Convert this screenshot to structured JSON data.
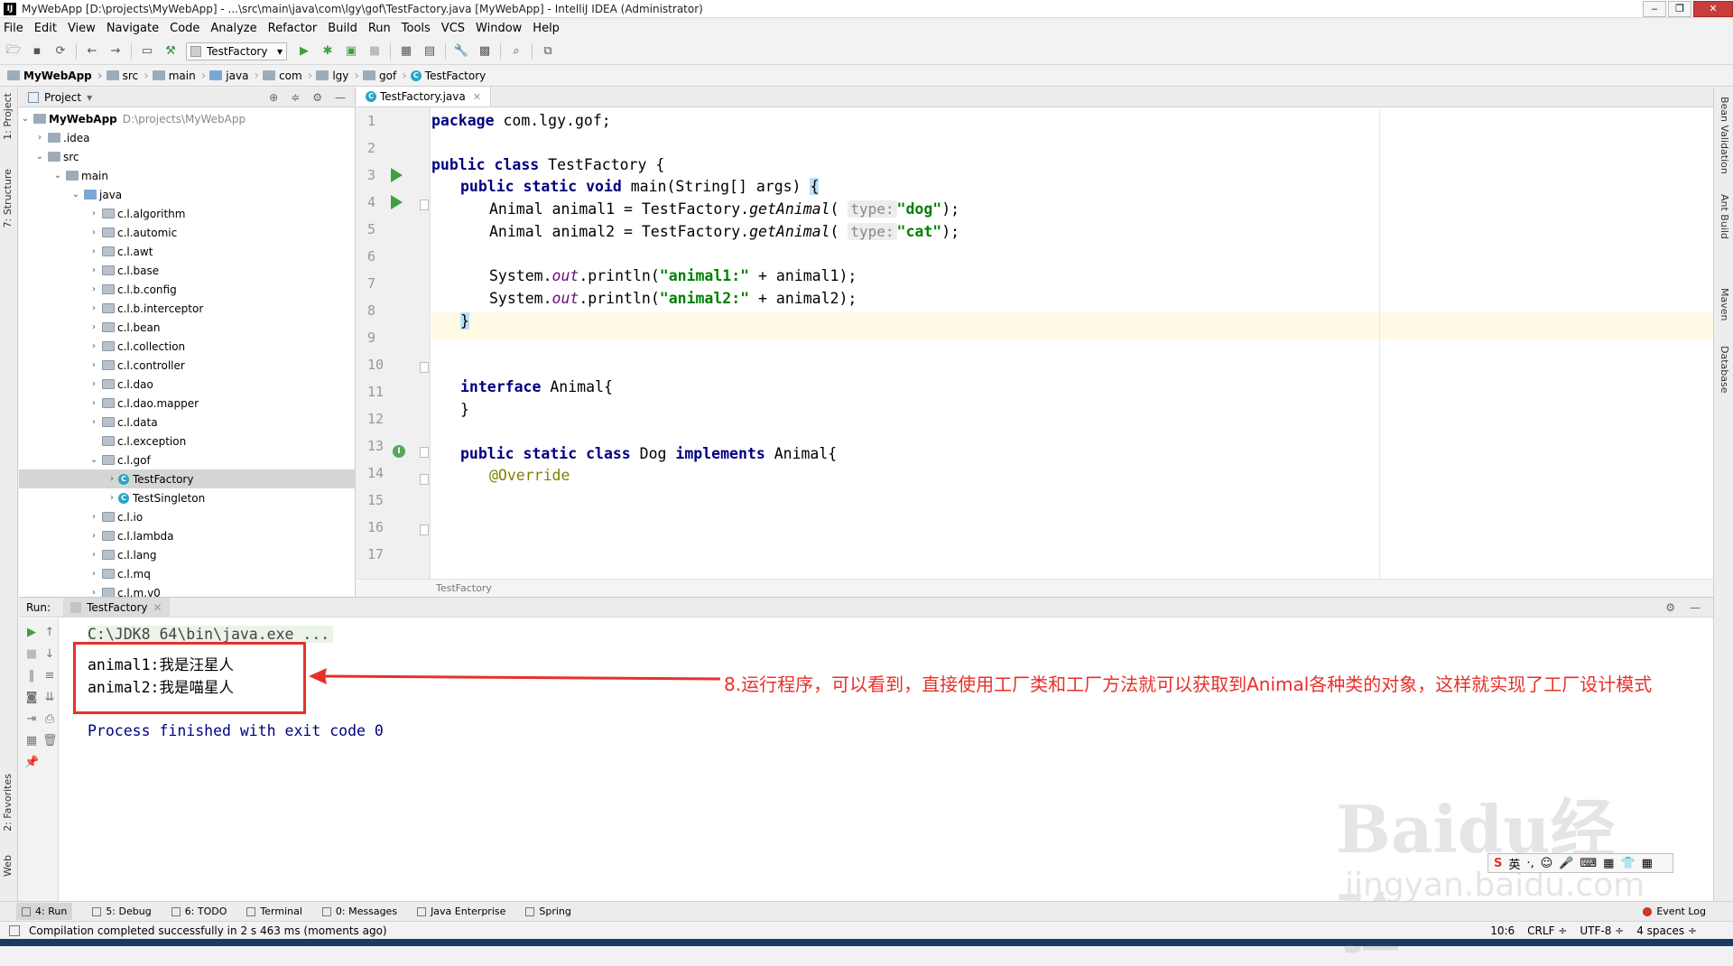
{
  "window": {
    "title": "MyWebApp [D:\\projects\\MyWebApp] - ...\\src\\main\\java\\com\\lgy\\gof\\TestFactory.java [MyWebApp] - IntelliJ IDEA (Administrator)",
    "app_badge": "IJ"
  },
  "menu": [
    "File",
    "Edit",
    "View",
    "Navigate",
    "Code",
    "Analyze",
    "Refactor",
    "Build",
    "Run",
    "Tools",
    "VCS",
    "Window",
    "Help"
  ],
  "toolbar": {
    "run_config": "TestFactory"
  },
  "breadcrumb": [
    "MyWebApp",
    "src",
    "main",
    "java",
    "com",
    "lgy",
    "gof",
    "TestFactory"
  ],
  "left_strip": {
    "project_tab": "1: Project",
    "structure_tab": "7: Structure",
    "favorites_tab": "2: Favorites",
    "web_tab": "Web"
  },
  "right_strip": {
    "tabs": [
      "Bean Validation",
      "Ant Build",
      "Maven",
      "Database"
    ]
  },
  "project_panel": {
    "title": "Project",
    "root_name": "MyWebApp",
    "root_path": "D:\\projects\\MyWebApp",
    "items": [
      ".idea",
      "src",
      "main",
      "java",
      "c.l.algorithm",
      "c.l.automic",
      "c.l.awt",
      "c.l.base",
      "c.l.b.config",
      "c.l.b.interceptor",
      "c.l.bean",
      "c.l.collection",
      "c.l.controller",
      "c.l.dao",
      "c.l.dao.mapper",
      "c.l.data",
      "c.l.exception",
      "c.l.gof",
      "TestFactory",
      "TestSingleton",
      "c.l.io",
      "c.l.lambda",
      "c.l.lang",
      "c.l.mq",
      "c.l.m.v0"
    ]
  },
  "editor": {
    "tab_label": "TestFactory.java",
    "footer_crumb": "TestFactory",
    "line_numbers": [
      "1",
      "2",
      "3",
      "4",
      "5",
      "6",
      "7",
      "8",
      "9",
      "10",
      "11",
      "12",
      "13",
      "14",
      "15",
      "16",
      "17"
    ],
    "code": {
      "l1_kw": "package",
      "l1_rest": " com.lgy.gof;",
      "l3_kw": "public class",
      "l3_rest": " TestFactory {",
      "l4_kw": "public static void",
      "l4_rest": " main(String[] args) ",
      "l4_brace": "{",
      "l5_pre": "Animal animal1 = TestFactory.",
      "l5_m": "getAnimal",
      "l5_open": "(",
      "l5_hint": "type:",
      "l5_str": "\"dog\"",
      "l5_end": ");",
      "l6_pre": "Animal animal2 = TestFactory.",
      "l6_m": "getAnimal",
      "l6_open": "(",
      "l6_hint": "type:",
      "l6_str": "\"cat\"",
      "l6_end": ");",
      "l8_pre": "System.",
      "l8_out": "out",
      "l8_mid": ".println(",
      "l8_str": "\"animal1:\"",
      "l8_end": " + animal1);",
      "l9_pre": "System.",
      "l9_out": "out",
      "l9_mid": ".println(",
      "l9_str": "\"animal2:\"",
      "l9_end": " + animal2);",
      "l10": "}",
      "l13_kw": "interface",
      "l13_rest": " Animal{",
      "l14": "}",
      "l16_kw1": "public static class",
      "l16_mid": " Dog ",
      "l16_kw2": "implements",
      "l16_rest": " Animal{",
      "l17": "@Override"
    }
  },
  "run_panel": {
    "label": "Run:",
    "tab": "TestFactory",
    "cmd": "C:\\JDK8_64\\bin\\java.exe ...",
    "out1": "animal1:我是汪星人",
    "out2": "animal2:我是喵星人",
    "finished": "Process finished with exit code 0"
  },
  "annotation": {
    "text": "8.运行程序，可以看到，直接使用工厂类和工厂方法就可以获取到Animal各种类的对象，这样就实现了工厂设计模式",
    "color": "#e8302a"
  },
  "watermark": {
    "brand": "Baidu经验",
    "url": "jingyan.baidu.com"
  },
  "ime": {
    "mode": "英"
  },
  "bottom_tabs": [
    "4: Run",
    "5: Debug",
    "6: TODO",
    "Terminal",
    "0: Messages",
    "Java Enterprise",
    "Spring",
    "Event Log"
  ],
  "status": {
    "message": "Compilation completed successfully in 2 s 463 ms (moments ago)",
    "position": "10:6",
    "line_sep": "CRLF ÷",
    "encoding": "UTF-8 ÷",
    "indent": "4 spaces ÷"
  }
}
